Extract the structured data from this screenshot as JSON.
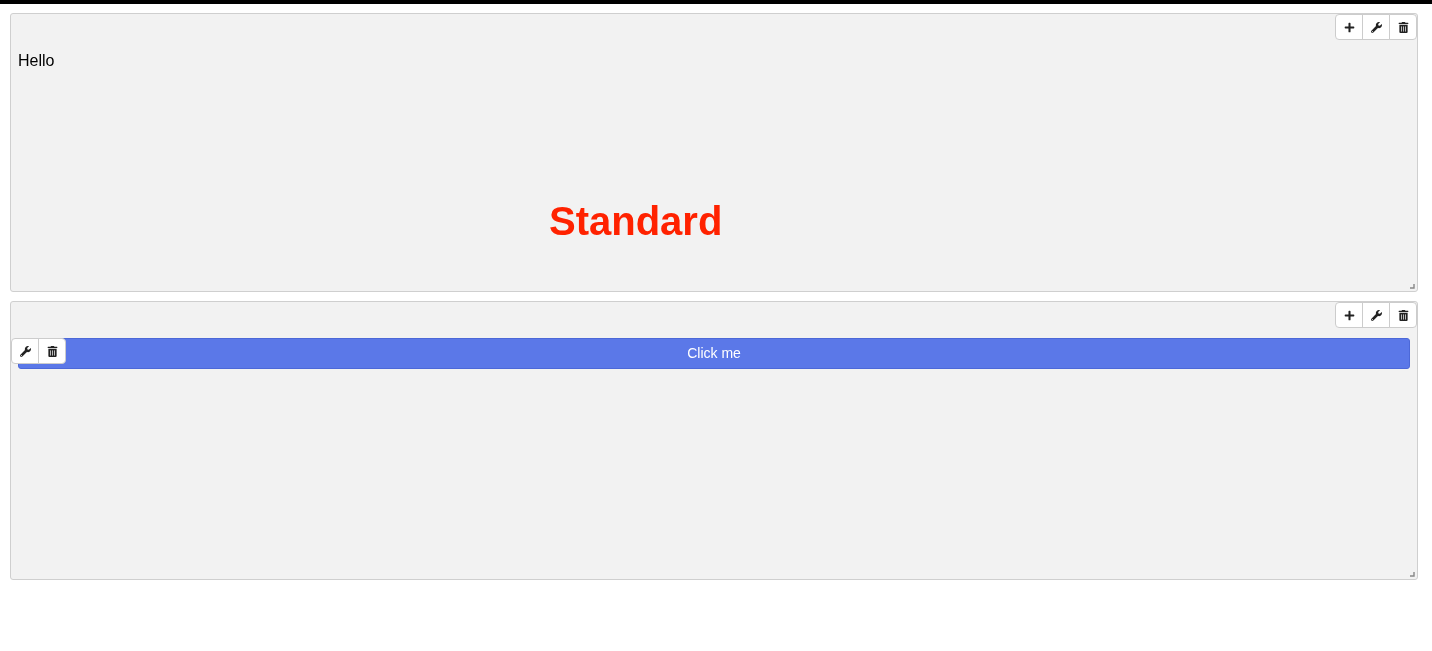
{
  "panels": [
    {
      "kind": "text",
      "paragraph": "Hello",
      "heading": "Standard"
    },
    {
      "kind": "button",
      "button_label": "Click me"
    }
  ]
}
